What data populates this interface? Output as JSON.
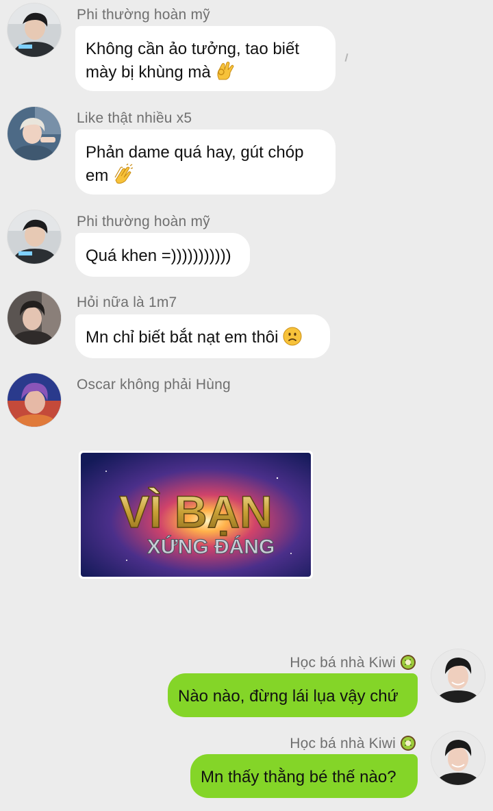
{
  "messages": [
    {
      "sender": "Phi thường hoàn mỹ",
      "line1": "Không cần ảo tưởng, tao biết",
      "line2": "mày bị khùng mà",
      "emoji": "ok-hand"
    },
    {
      "sender": "Like thật nhiều x5",
      "line1": "Phản dame quá hay, gút chóp",
      "line2": "em",
      "emoji": "clapping-hands"
    },
    {
      "sender": "Phi thường hoàn mỹ",
      "text": "Quá khen =)))))))))))"
    },
    {
      "sender": "Hỏi nữa là 1m7",
      "text": "Mn chỉ biết bắt nạt em thôi",
      "emoji": "slightly-frowning-face"
    },
    {
      "sender": "Oscar không phải Hùng",
      "image_text_line1": "VÌ BẠN",
      "image_text_line2": "XỨNG ĐÁNG"
    },
    {
      "sender": "Học bá nhà Kiwi",
      "text": "Nào nào, đừng lái lụa vậy chứ",
      "emoji": "kiwi"
    },
    {
      "sender": "Học bá nhà Kiwi",
      "text": "Mn thấy thằng bé thế nào?",
      "emoji": "kiwi"
    }
  ],
  "colors": {
    "background": "#ececec",
    "incoming_bubble": "#ffffff",
    "outgoing_bubble": "#84d528",
    "sender_name": "#6f6f6f"
  }
}
